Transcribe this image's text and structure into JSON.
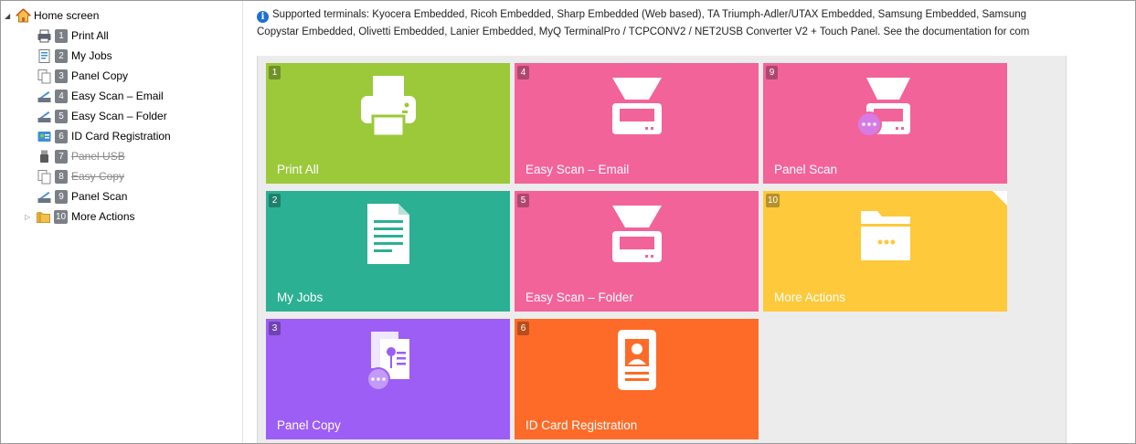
{
  "tree": {
    "root_label": "Home screen",
    "items": [
      {
        "num": "1",
        "label": "Print All",
        "icon": "printer-icon",
        "disabled": false
      },
      {
        "num": "2",
        "label": "My Jobs",
        "icon": "document-icon",
        "disabled": false
      },
      {
        "num": "3",
        "label": "Panel Copy",
        "icon": "copy-icon",
        "disabled": false
      },
      {
        "num": "4",
        "label": "Easy Scan – Email",
        "icon": "scanner-icon",
        "disabled": false
      },
      {
        "num": "5",
        "label": "Easy Scan – Folder",
        "icon": "scanner-icon",
        "disabled": false
      },
      {
        "num": "6",
        "label": "ID Card Registration",
        "icon": "id-card-icon",
        "disabled": false
      },
      {
        "num": "7",
        "label": "Panel USB",
        "icon": "usb-icon",
        "disabled": true
      },
      {
        "num": "8",
        "label": "Easy Copy",
        "icon": "copy-icon",
        "disabled": true
      },
      {
        "num": "9",
        "label": "Panel Scan",
        "icon": "scanner-icon",
        "disabled": false
      },
      {
        "num": "10",
        "label": "More Actions",
        "icon": "folder-icon",
        "disabled": false
      }
    ]
  },
  "info": {
    "line1": "Supported terminals: Kyocera Embedded, Ricoh Embedded, Sharp Embedded (Web based), TA Triumph-Adler/UTAX Embedded, Samsung Embedded, Samsung",
    "line2": "Copystar Embedded, Olivetti Embedded, Lanier Embedded, MyQ TerminalPro / TCPCONV2 / NET2USB Converter V2 + Touch Panel. See the documentation for com"
  },
  "tiles": [
    {
      "num": "1",
      "label": "Print All",
      "color": "#9bc93a",
      "icon": "printer-icon"
    },
    {
      "num": "4",
      "label": "Easy Scan – Email",
      "color": "#f2639a",
      "icon": "scanner-icon"
    },
    {
      "num": "9",
      "label": "Panel Scan",
      "color": "#f2639a",
      "icon": "panel-scan-icon"
    },
    {
      "num": "2",
      "label": "My Jobs",
      "color": "#2bb094",
      "icon": "document-icon"
    },
    {
      "num": "5",
      "label": "Easy Scan – Folder",
      "color": "#f2639a",
      "icon": "scanner-icon"
    },
    {
      "num": "10",
      "label": "More Actions",
      "color": "#fec93a",
      "icon": "folder-icon"
    },
    {
      "num": "3",
      "label": "Panel Copy",
      "color": "#9c5ef5",
      "icon": "panel-copy-icon"
    },
    {
      "num": "6",
      "label": "ID Card Registration",
      "color": "#fe6b28",
      "icon": "id-card-icon"
    }
  ]
}
